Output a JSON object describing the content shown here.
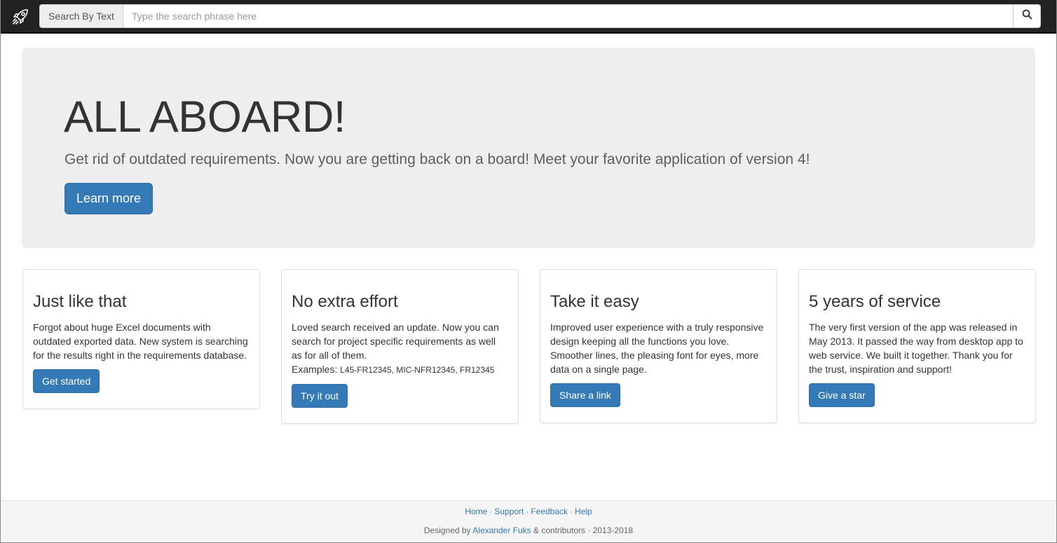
{
  "navbar": {
    "brand_icon": "rocket-icon",
    "search_mode_label": "Search By Text",
    "search_placeholder": "Type the search phrase here",
    "search_value": "",
    "search_button_icon": "search-icon"
  },
  "jumbotron": {
    "title": "ALL ABOARD!",
    "lead": "Get rid of outdated requirements. Now you are getting back on a board! Meet your favorite application of version 4!",
    "button_label": "Learn more"
  },
  "cards": [
    {
      "title": "Just like that",
      "text": "Forgot about huge Excel documents with outdated exported data. New system is searching for the results right in the requirements database.",
      "button_label": "Get started"
    },
    {
      "title": "No extra effort",
      "text": "Loved search received an update. Now you can search for project specific requirements as well as for all of them.",
      "examples_label": "Examples:",
      "examples_codes": "L45-FR12345, MIC-NFR12345, FR12345",
      "button_label": "Try it out"
    },
    {
      "title": "Take it easy",
      "text": "Improved user experience with a truly responsive design keeping all the functions you love. Smoother lines, the pleasing font for eyes, more data on a single page.",
      "button_label": "Share a link"
    },
    {
      "title": "5 years of service",
      "text": "The very first version of the app was released in May 2013. It passed the way from desktop app to web service. We built it together. Thank you for the trust, inspiration and support!",
      "button_label": "Give a star"
    }
  ],
  "footer": {
    "links": [
      "Home",
      "Support",
      "Feedback",
      "Help"
    ],
    "separator": "·",
    "credit_prefix": "Designed by",
    "credit_author": "Alexander Fuks",
    "credit_suffix": "& contributors · 2013-2018"
  },
  "colors": {
    "primary": "#337ab7",
    "navbar_bg": "#222222",
    "jumbotron_bg": "#eeeeee",
    "footer_bg": "#f5f5f5"
  }
}
